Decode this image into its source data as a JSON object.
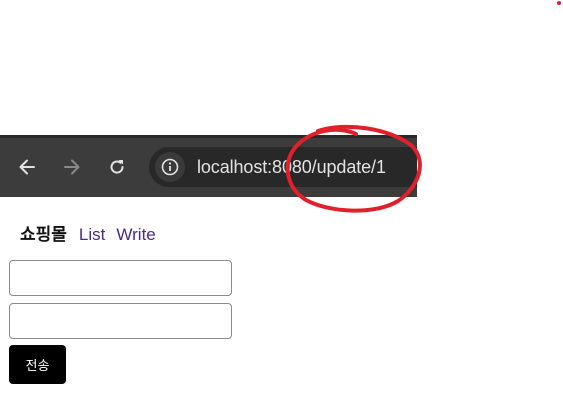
{
  "browser": {
    "url": "localhost:8080/update/1"
  },
  "navbar": {
    "brand": "쇼핑몰",
    "links": [
      {
        "label": "List"
      },
      {
        "label": "Write"
      }
    ]
  },
  "form": {
    "fields": [
      {
        "value": "",
        "placeholder": ""
      },
      {
        "value": "",
        "placeholder": ""
      }
    ],
    "submit_label": "전송"
  },
  "icons": [
    "back-arrow-icon",
    "forward-arrow-icon",
    "reload-icon",
    "info-icon"
  ],
  "colors": {
    "browser_bar": "#3c3c3c",
    "omnibox": "#282828",
    "annotation": "#e0202a",
    "link": "#4a2a8a",
    "button": "#000000"
  }
}
